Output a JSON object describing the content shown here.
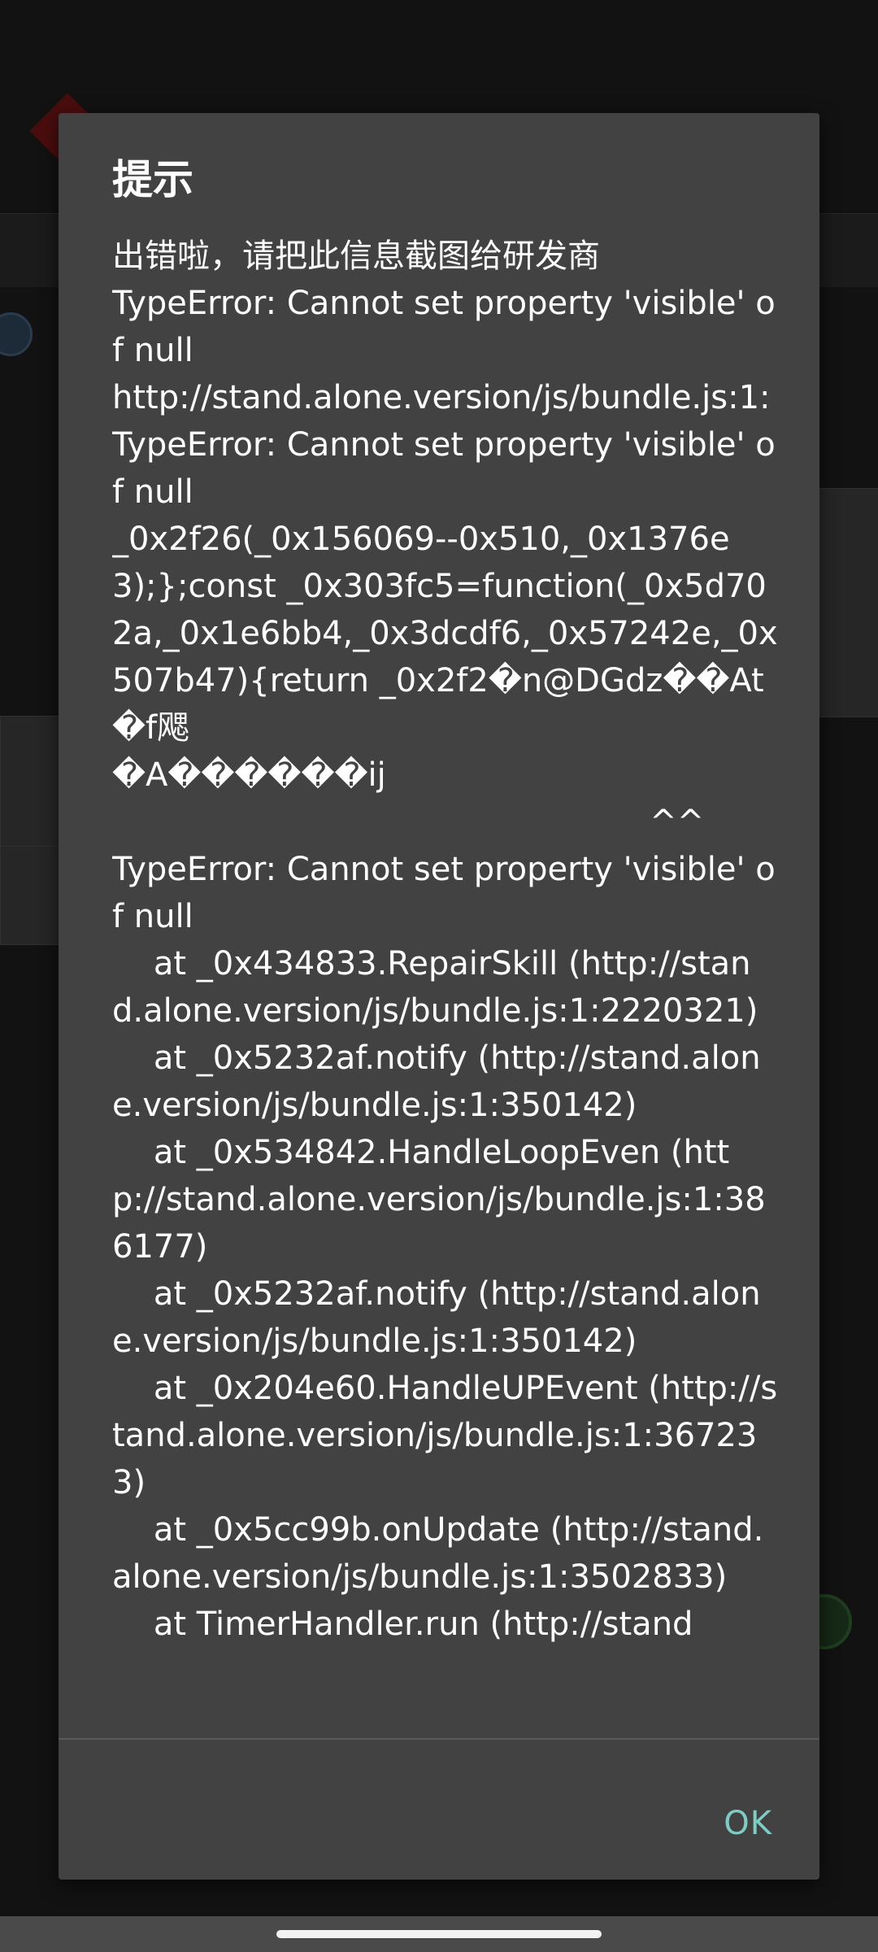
{
  "dialog": {
    "title": "提示",
    "message": "出错啦，请把此信息截图给研发商\nTypeError: Cannot set property 'visible' of null\nhttp://stand.alone.version/js/bundle.js:1:\nTypeError: Cannot set property 'visible' of null\n_0x2f26(_0x156069--0x510,_0x1376e3);};const _0x303fc5=function(_0x5d702a,_0x1e6bb4,_0x3dcdf6,_0x57242e,_0x507b47){return _0x2f2�n￼￼@DGdz��At�f飔\n�A������ij\n                                                    ^^\nTypeError: Cannot set property 'visible' of null\n    at _0x434833.RepairSkill (http://stand.alone.version/js/bundle.js:1:2220321)\n    at _0x5232af.notify (http://stand.alone.version/js/bundle.js:1:350142)\n    at _0x534842.HandleLoopEven (http://stand.alone.version/js/bundle.js:1:386177)\n    at _0x5232af.notify (http://stand.alone.version/js/bundle.js:1:350142)\n    at _0x204e60.HandleUPEvent (http://stand.alone.version/js/bundle.js:1:367233)\n    at _0x5cc99b.onUpdate (http://stand.alone.version/js/bundle.js:1:3502833)\n    at TimerHandler.run (http://stand",
    "ok_label": "OK"
  },
  "colors": {
    "dialog_bg": "#424242",
    "button_text": "#80cbc4",
    "text": "#ffffff"
  }
}
